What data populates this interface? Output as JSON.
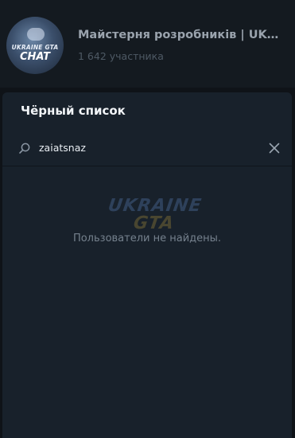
{
  "chat": {
    "title": "Майстерня розробників | UKRAINE GTA CHAT",
    "subtitle": "1 642 участника",
    "avatar_text_top": "UKRAINE GTA",
    "avatar_text_bottom": "CHAT"
  },
  "blacklist": {
    "title": "Чёрный список",
    "search": {
      "value": "zaiatsnaz",
      "search_icon": "search-icon",
      "clear_icon": "close-icon"
    },
    "watermark": {
      "line1": "UKRAINE",
      "line2": "GTA"
    },
    "empty_message": "Пользователи не найдены."
  }
}
